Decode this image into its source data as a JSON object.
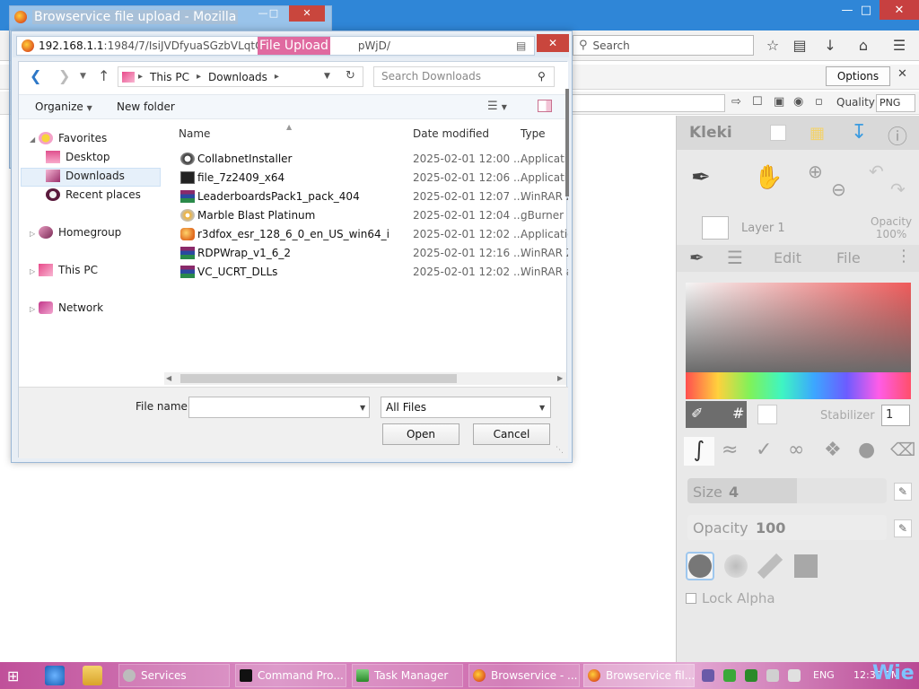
{
  "browser": {
    "search_placeholder": "Search",
    "options_label": "Options",
    "quality_label": "Quality",
    "quality_value": "PNG"
  },
  "popup": {
    "title": "Browservice file upload - Mozilla"
  },
  "dialog": {
    "url_host": "192.168.1.1",
    "url_rest": ":1984/7/IsiJVDfyuaSGzbVLqtQaKNv",
    "url_tail": "pWjD/",
    "url_overlay_label": "File Upload"
  },
  "file_dialog": {
    "path": [
      "This PC",
      "Downloads"
    ],
    "search_placeholder": "Search Downloads",
    "organize_label": "Organize",
    "new_folder_label": "New folder",
    "tree": {
      "favorites": "Favorites",
      "desktop": "Desktop",
      "downloads": "Downloads",
      "recent": "Recent places",
      "homegroup": "Homegroup",
      "this_pc": "This PC",
      "network": "Network"
    },
    "columns": {
      "name": "Name",
      "date": "Date modified",
      "type": "Type"
    },
    "files": [
      {
        "name": "CollabnetInstaller",
        "date": "2025-02-01 12:00 ...",
        "type": "Applicatio",
        "icon": "installer"
      },
      {
        "name": "file_7z2409_x64",
        "date": "2025-02-01 12:06 ...",
        "type": "Applicatio",
        "icon": "7zip"
      },
      {
        "name": "LeaderboardsPack1_pack_404",
        "date": "2025-02-01 12:07 ...",
        "type": "WinRAR Z",
        "icon": "winrar"
      },
      {
        "name": "Marble Blast Platinum",
        "date": "2025-02-01 12:04 ...",
        "type": "gBurner F",
        "icon": "disc"
      },
      {
        "name": "r3dfox_esr_128_6_0_en_US_win64_i",
        "date": "2025-02-01 12:02 ...",
        "type": "Applicatio",
        "icon": "fox"
      },
      {
        "name": "RDPWrap_v1_6_2",
        "date": "2025-02-01 12:16 ...",
        "type": "WinRAR Z",
        "icon": "winrar"
      },
      {
        "name": "VC_UCRT_DLLs",
        "date": "2025-02-01 12:02 ...",
        "type": "WinRAR a",
        "icon": "winrar"
      }
    ],
    "file_name_label": "File name:",
    "file_name_value": "",
    "filter_value": "All Files",
    "open_label": "Open",
    "cancel_label": "Cancel"
  },
  "kleki": {
    "logo": "Kleki",
    "layer_name": "Layer 1",
    "opacity_label": "Opacity",
    "opacity_value": "100%",
    "tab_edit": "Edit",
    "tab_file": "File",
    "hash": "#",
    "stabilizer_label": "Stabilizer",
    "stabilizer_value": "1",
    "size_label": "Size",
    "size_value": "4",
    "brush_opacity_label": "Opacity",
    "brush_opacity_value": "100",
    "lock_alpha_label": "Lock Alpha"
  },
  "taskbar": {
    "tasks": [
      {
        "label": "Services"
      },
      {
        "label": "Command Pro..."
      },
      {
        "label": "Task Manager"
      },
      {
        "label": "Browservice - ..."
      },
      {
        "label": "Browservice fil..."
      }
    ],
    "language": "ENG",
    "clock": "12:30 PM",
    "brand": "Wie"
  },
  "colors": {
    "title_blue": "#2f86d7",
    "accent_pink": "#e06aa0",
    "close_red": "#c9463d"
  }
}
